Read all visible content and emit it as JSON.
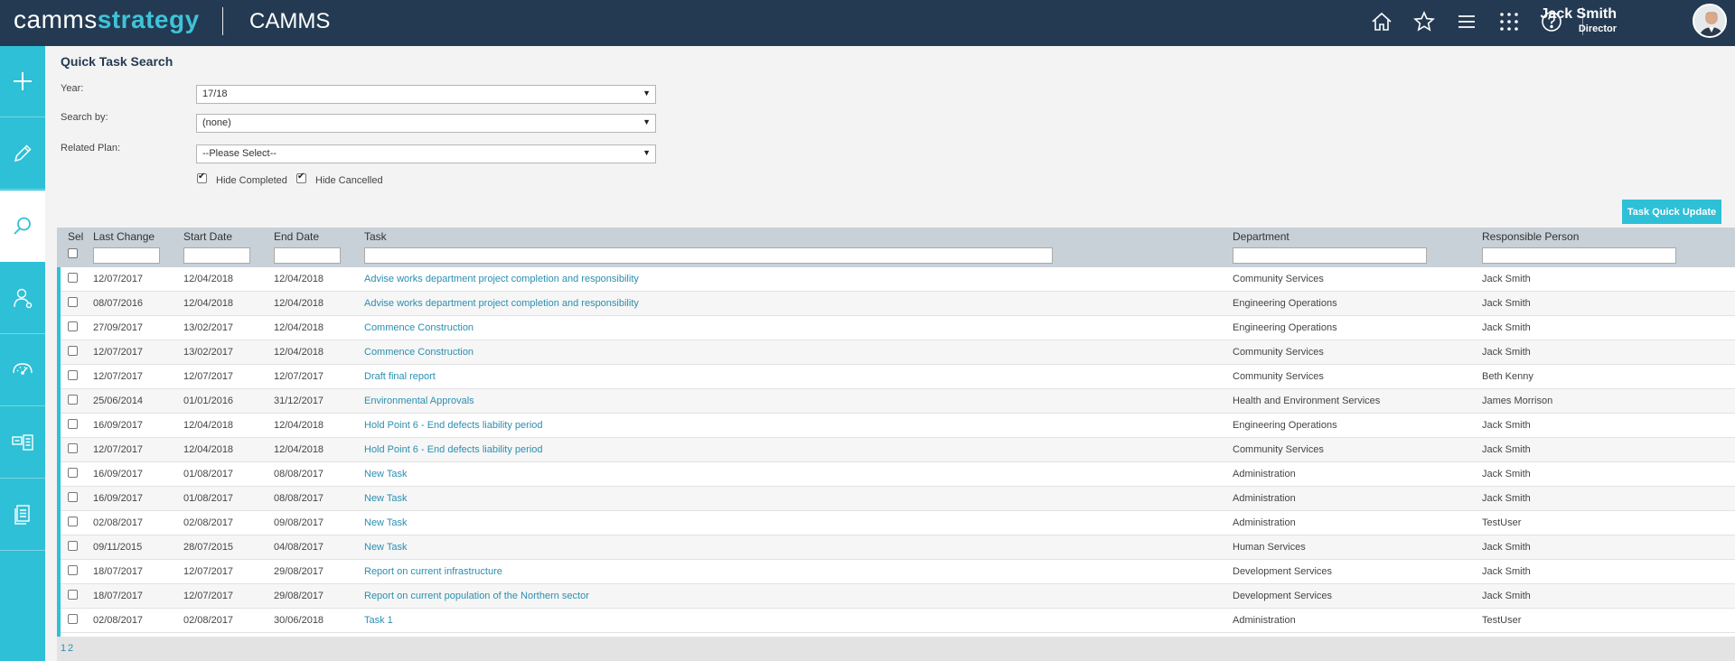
{
  "header": {
    "logo_part1": "camms",
    "logo_part2": "strategy",
    "app_title": "CAMMS",
    "user_name": "Jack Smith",
    "user_role": "Director",
    "icons": [
      "home-icon",
      "star-icon",
      "menu-icon",
      "grid-icon",
      "help-icon"
    ]
  },
  "sidebar": {
    "items": [
      "add-icon",
      "pencil-icon",
      "search-icon",
      "user-icon",
      "gauge-icon",
      "cards-icon",
      "document-icon"
    ],
    "active": "search-icon"
  },
  "form": {
    "title": "Quick Task Search",
    "year_label": "Year:",
    "year_value": "17/18",
    "searchby_label": "Search by:",
    "searchby_value": "(none)",
    "plan_label": "Related Plan:",
    "plan_value": "--Please Select--",
    "hide_completed_label": "Hide Completed",
    "hide_completed": true,
    "hide_cancelled_label": "Hide Cancelled",
    "hide_cancelled": true,
    "quick_update_label": "Task Quick Update"
  },
  "table": {
    "columns": [
      "Sel",
      "Last Change",
      "Start Date",
      "End Date",
      "Task",
      "Department",
      "Responsible Person"
    ],
    "rows": [
      [
        "12/07/2017",
        "12/04/2018",
        "12/04/2018",
        "Advise works department project completion and responsibility",
        "Community Services",
        "Jack Smith"
      ],
      [
        "08/07/2016",
        "12/04/2018",
        "12/04/2018",
        "Advise works department project completion and responsibility",
        "Engineering Operations",
        "Jack Smith"
      ],
      [
        "27/09/2017",
        "13/02/2017",
        "12/04/2018",
        "Commence Construction",
        "Engineering Operations",
        "Jack Smith"
      ],
      [
        "12/07/2017",
        "13/02/2017",
        "12/04/2018",
        "Commence Construction",
        "Community Services",
        "Jack Smith"
      ],
      [
        "12/07/2017",
        "12/07/2017",
        "12/07/2017",
        "Draft final report",
        "Community Services",
        "Beth Kenny"
      ],
      [
        "25/06/2014",
        "01/01/2016",
        "31/12/2017",
        "Environmental Approvals",
        "Health and Environment Services",
        "James Morrison"
      ],
      [
        "16/09/2017",
        "12/04/2018",
        "12/04/2018",
        "Hold Point 6 - End defects liability period",
        "Engineering Operations",
        "Jack Smith"
      ],
      [
        "12/07/2017",
        "12/04/2018",
        "12/04/2018",
        "Hold Point 6 - End defects liability period",
        "Community Services",
        "Jack Smith"
      ],
      [
        "16/09/2017",
        "01/08/2017",
        "08/08/2017",
        "New Task",
        "Administration",
        "Jack Smith"
      ],
      [
        "16/09/2017",
        "01/08/2017",
        "08/08/2017",
        "New Task",
        "Administration",
        "Jack Smith"
      ],
      [
        "02/08/2017",
        "02/08/2017",
        "09/08/2017",
        "New Task",
        "Administration",
        "TestUser"
      ],
      [
        "09/11/2015",
        "28/07/2015",
        "04/08/2017",
        "New Task",
        "Human Services",
        "Jack Smith"
      ],
      [
        "18/07/2017",
        "12/07/2017",
        "29/08/2017",
        "Report on current infrastructure",
        "Development Services",
        "Jack Smith"
      ],
      [
        "18/07/2017",
        "12/07/2017",
        "29/08/2017",
        "Report on current population of the Northern sector",
        "Development Services",
        "Jack Smith"
      ],
      [
        "02/08/2017",
        "02/08/2017",
        "30/06/2018",
        "Task 1",
        "Administration",
        "TestUser"
      ]
    ],
    "pages": [
      "1",
      "2"
    ]
  }
}
